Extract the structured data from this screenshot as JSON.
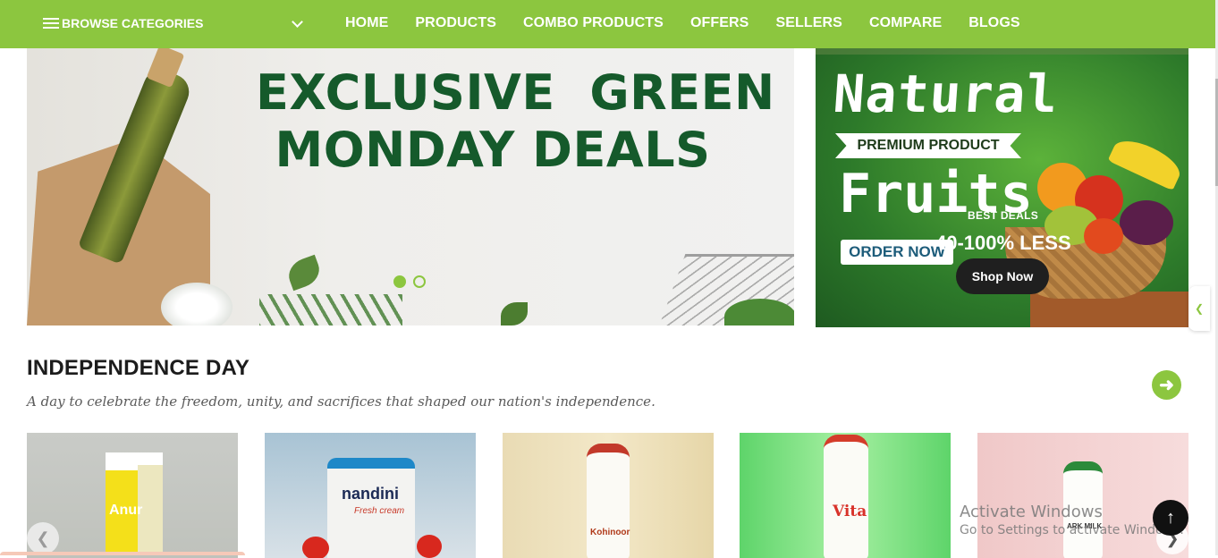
{
  "nav": {
    "browse_label": "BROWSE CATEGORIES",
    "links": [
      "HOME",
      "PRODUCTS",
      "COMBO PRODUCTS",
      "OFFERS",
      "SELLERS",
      "COMPARE",
      "BLOGS"
    ]
  },
  "hero": {
    "title_line1": "EXCLUSIVE  GREEN",
    "title_line2": "MONDAY DEALS",
    "slide_count": 2,
    "active_slide": 1
  },
  "side_banner": {
    "natural": "Natural",
    "premium": "PREMIUM PRODUCT",
    "fruits": "Fruits",
    "order_now": "ORDER NOW",
    "best_deals": "BEST DEALS",
    "discount": "40-100% LESS",
    "shop_now": "Shop Now"
  },
  "section": {
    "title": "INDEPENDENCE DAY",
    "subtitle": "A day to celebrate the freedom, unity, and sacrifices that shaped our nation's independence."
  },
  "products": [
    {
      "brand": "Anur"
    },
    {
      "brand": "nandini",
      "sub": "Fresh cream"
    },
    {
      "brand": "Kohinoor"
    },
    {
      "brand": "Vita"
    },
    {
      "brand": "ARK MILK"
    }
  ],
  "watermark": {
    "line1": "Activate Windows",
    "line2": "Go to Settings to activate Windows."
  },
  "colors": {
    "brand_green": "#8cc63f",
    "title_green": "#155a2b",
    "dark": "#1f1f1f"
  },
  "icons": {
    "menu": "hamburger-icon",
    "dropdown": "chevron-down-icon",
    "next": "arrow-right-icon",
    "prev": "chevron-left-icon",
    "top": "arrow-up-icon"
  }
}
